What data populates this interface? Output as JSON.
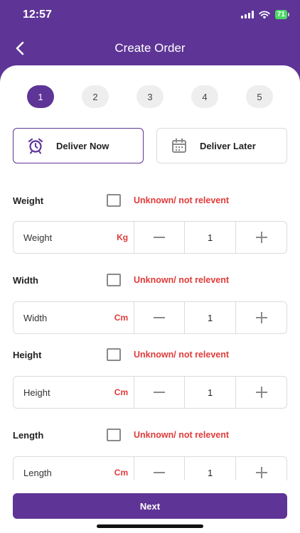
{
  "status": {
    "time": "12:57",
    "battery": "71"
  },
  "nav": {
    "title": "Create Order",
    "back_icon": "chevron-left-icon"
  },
  "steps": [
    "1",
    "2",
    "3",
    "4",
    "5"
  ],
  "active_step": "1",
  "delivery": {
    "now_label": "Deliver Now",
    "now_icon": "alarm-clock-icon",
    "later_label": "Deliver Later",
    "later_icon": "calendar-icon",
    "selected": "now"
  },
  "unknown_label": "Unknown/ not relevent",
  "dimensions": [
    {
      "label": "Weight",
      "placeholder": "Weight",
      "unit": "Kg",
      "value": "1"
    },
    {
      "label": "Width",
      "placeholder": "Width",
      "unit": "Cm",
      "value": "1"
    },
    {
      "label": "Height",
      "placeholder": "Height",
      "unit": "Cm",
      "value": "1"
    },
    {
      "label": "Length",
      "placeholder": "Length",
      "unit": "Cm",
      "value": "1"
    }
  ],
  "next_label": "Next",
  "colors": {
    "primary": "#5e3596",
    "accent_red": "#e03a3a",
    "border": "#dcdcdc"
  }
}
